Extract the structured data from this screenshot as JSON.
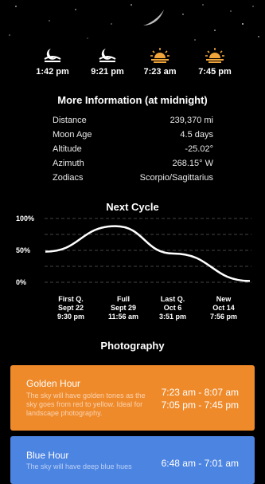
{
  "events": [
    {
      "icon": "moonrise-icon",
      "time": "1:42 pm"
    },
    {
      "icon": "moonset-icon",
      "time": "9:21 pm"
    },
    {
      "icon": "sunrise-icon",
      "time": "7:23 am"
    },
    {
      "icon": "sunset-icon",
      "time": "7:45 pm"
    }
  ],
  "more_info": {
    "title": "More Information (at midnight)",
    "rows": [
      {
        "label": "Distance",
        "value": "239,370 mi"
      },
      {
        "label": "Moon Age",
        "value": "4.5 days"
      },
      {
        "label": "Altitude",
        "value": "-25.02°"
      },
      {
        "label": "Azimuth",
        "value": "268.15° W"
      },
      {
        "label": "Zodiacs",
        "value": "Scorpio/Sagittarius"
      }
    ]
  },
  "next_cycle": {
    "title": "Next Cycle",
    "phases": [
      {
        "name": "First Q.",
        "date": "Sept 22",
        "time": "9:30 pm"
      },
      {
        "name": "Full",
        "date": "Sept 29",
        "time": "11:56 am"
      },
      {
        "name": "Last Q.",
        "date": "Oct 6",
        "time": "3:51 pm"
      },
      {
        "name": "New",
        "date": "Oct 14",
        "time": "7:56 pm"
      }
    ]
  },
  "chart_data": {
    "type": "line",
    "y_tick_labels": [
      "100%",
      "50%",
      "0%"
    ],
    "ylim": [
      0,
      100
    ],
    "grid": true,
    "series": [
      {
        "points": [
          [
            0,
            48
          ],
          [
            1,
            88
          ],
          [
            2,
            45
          ],
          [
            3,
            2
          ]
        ]
      }
    ]
  },
  "photography": {
    "title": "Photography",
    "golden": {
      "title": "Golden Hour",
      "desc": "The sky will have golden tones as the sky goes from red to yellow. Ideal for landscape photography.",
      "time1": "7:23 am - 8:07 am",
      "time2": "7:05 pm - 7:45 pm",
      "color": "#ef8a2b"
    },
    "blue": {
      "title": "Blue Hour",
      "desc": "The sky will have deep blue hues",
      "time1": "6:48 am - 7:01 am",
      "color": "#4c84e2"
    }
  }
}
